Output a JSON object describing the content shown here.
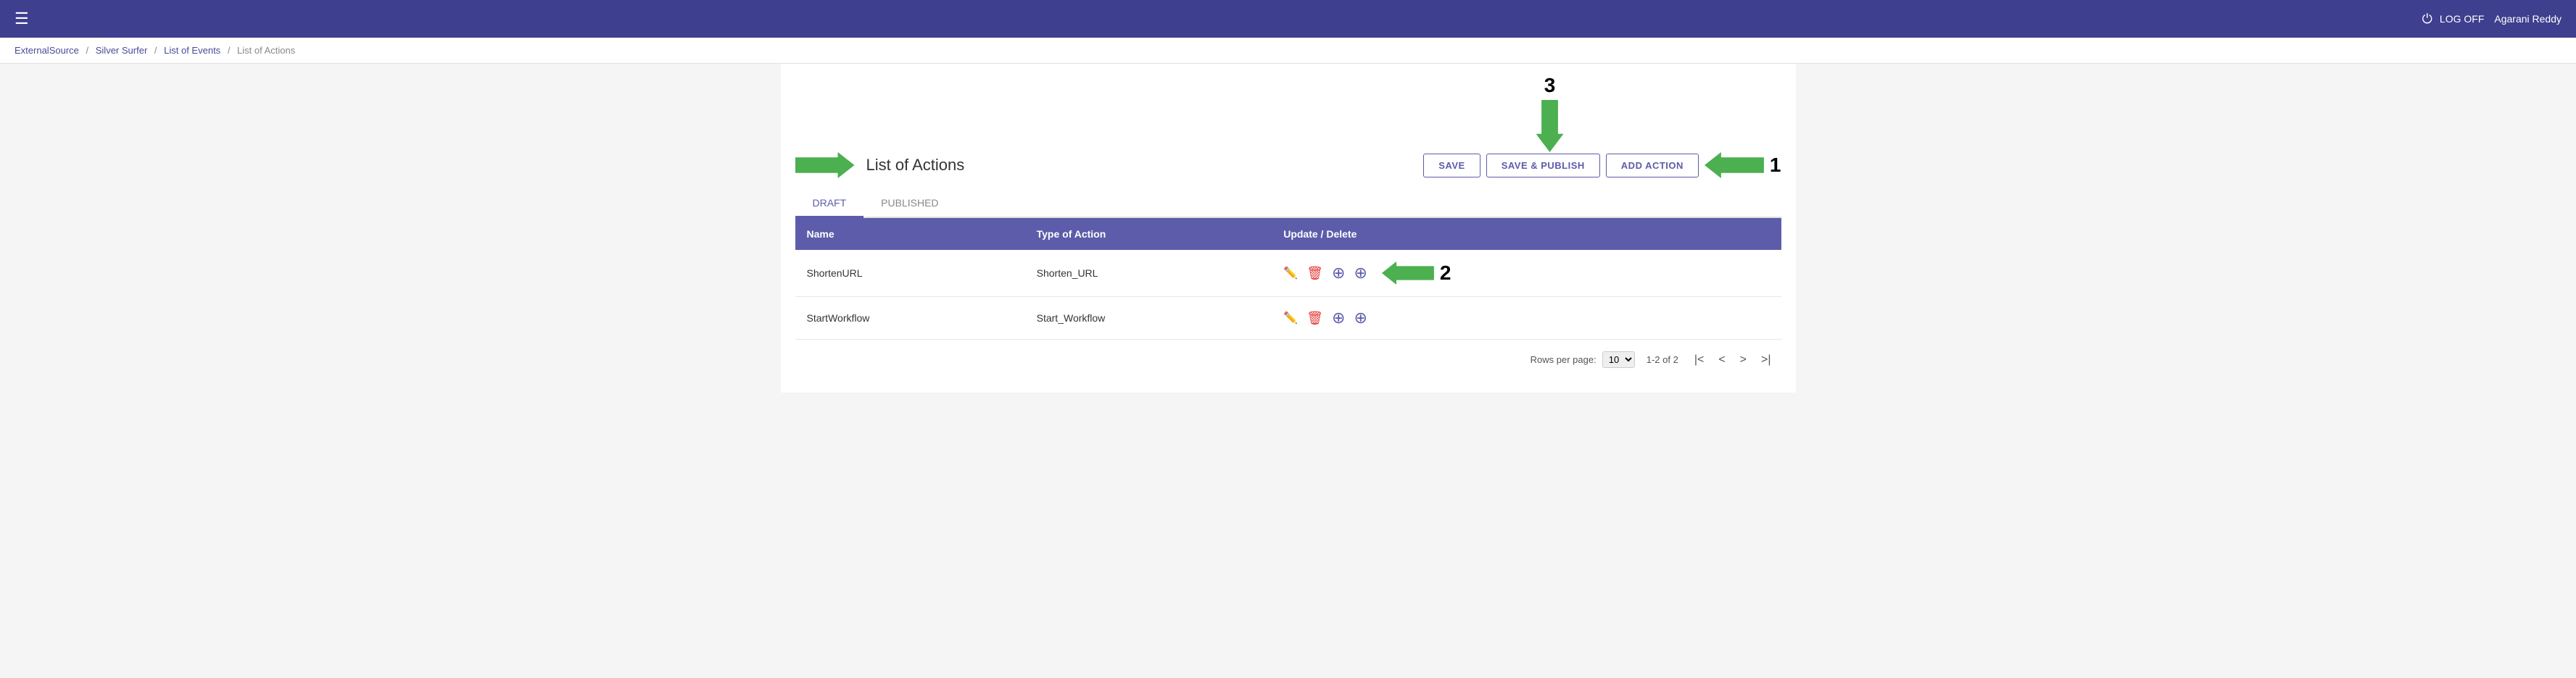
{
  "topbar": {
    "hamburger_icon": "☰",
    "logout_label": "LOG OFF",
    "user_name": "Agarani Reddy",
    "logout_icon": "⏻"
  },
  "breadcrumb": {
    "items": [
      {
        "label": "ExternalSource",
        "link": true
      },
      {
        "label": "Silver Surfer",
        "link": true
      },
      {
        "label": "List of Events",
        "link": true
      },
      {
        "label": "List of Actions",
        "link": false
      }
    ],
    "separator": "/"
  },
  "page": {
    "title": "List of Actions",
    "buttons": {
      "save": "SAVE",
      "save_publish": "SAVE & PUBLISH",
      "add_action": "ADD ACTION"
    },
    "tabs": [
      {
        "label": "DRAFT",
        "active": true
      },
      {
        "label": "PUBLISHED",
        "active": false
      }
    ],
    "table": {
      "headers": [
        "Name",
        "Type of Action",
        "Update / Delete"
      ],
      "rows": [
        {
          "name": "ShortenURL",
          "type": "Shorten_URL"
        },
        {
          "name": "StartWorkflow",
          "type": "Start_Workflow"
        }
      ]
    },
    "pagination": {
      "rows_per_page_label": "Rows per page:",
      "rows_per_page_value": "10",
      "range_label": "1-2 of 2"
    }
  },
  "annotations": {
    "arrow1_number": "1",
    "arrow2_number": "2",
    "arrow3_number": "3"
  }
}
